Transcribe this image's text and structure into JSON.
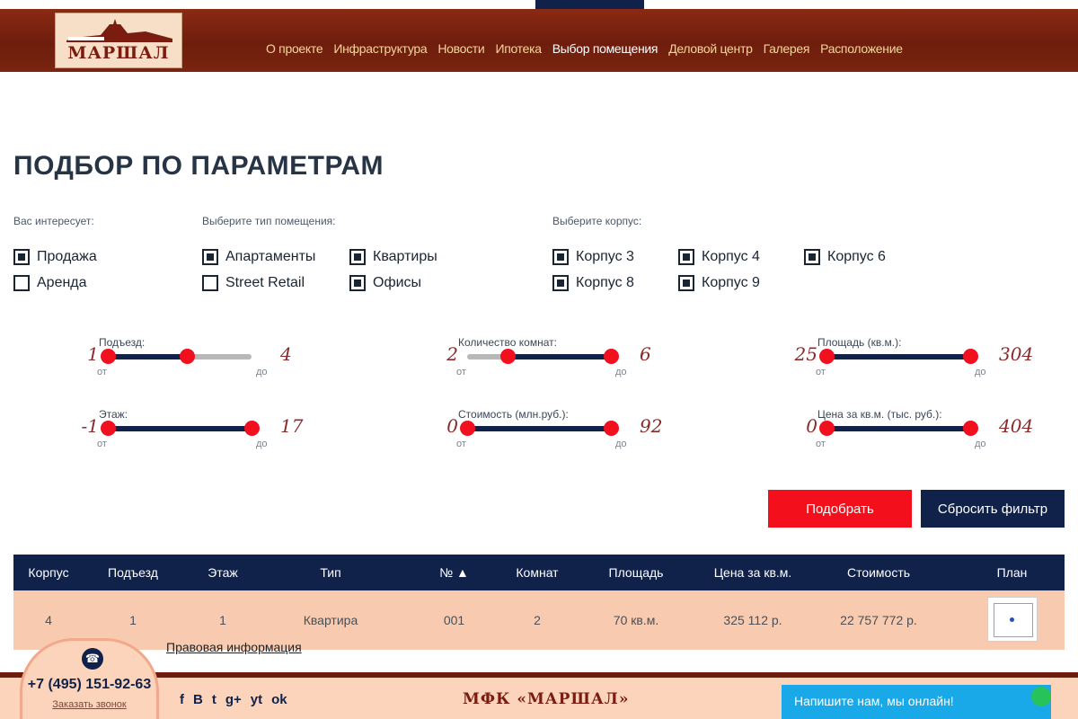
{
  "brand": {
    "logo_text": "МАРШАЛ",
    "footer_brand": "МФК «МАРШАЛ»"
  },
  "nav": [
    {
      "label": "О проекте",
      "active": false
    },
    {
      "label": "Инфраструктура",
      "active": false
    },
    {
      "label": "Новости",
      "active": false
    },
    {
      "label": "Ипотека",
      "active": false
    },
    {
      "label": "Выбор помещения",
      "active": true
    },
    {
      "label": "Деловой центр",
      "active": false
    },
    {
      "label": "Галерея",
      "active": false
    },
    {
      "label": "Расположение",
      "active": false
    }
  ],
  "page": {
    "title": "ПОДБОР ПО ПАРАМЕТРАМ"
  },
  "filters": {
    "interest": {
      "label": "Вас интересует:",
      "options": [
        {
          "label": "Продажа",
          "checked": true
        },
        {
          "label": "Аренда",
          "checked": false
        }
      ]
    },
    "type": {
      "label": "Выберите тип помещения:",
      "options": [
        {
          "label": "Апартаменты",
          "checked": true
        },
        {
          "label": "Street Retail",
          "checked": false
        },
        {
          "label": "Квартиры",
          "checked": true
        },
        {
          "label": "Офисы",
          "checked": true
        }
      ]
    },
    "building": {
      "label": "Выберите корпус:",
      "options": [
        {
          "label": "Корпус 3",
          "checked": true
        },
        {
          "label": "Корпус 8",
          "checked": true
        },
        {
          "label": "Корпус 4",
          "checked": true
        },
        {
          "label": "Корпус 9",
          "checked": true
        },
        {
          "label": "Корпус 6",
          "checked": true
        }
      ]
    }
  },
  "ranges": {
    "from_label": "от",
    "to_label": "до",
    "entrance": {
      "label": "Подъезд:",
      "min": "1",
      "max": "4",
      "lo": 0,
      "hi": 0.55
    },
    "floor": {
      "label": "Этаж:",
      "min": "-1",
      "max": "17",
      "lo": 0,
      "hi": 1
    },
    "rooms": {
      "label": "Количество комнат:",
      "min": "2",
      "max": "6",
      "lo": 0.28,
      "hi": 1
    },
    "cost": {
      "label": "Стоимость (млн.руб.):",
      "min": "0",
      "max": "92",
      "lo": 0,
      "hi": 1
    },
    "area": {
      "label": "Площадь (кв.м.):",
      "min": "25",
      "max": "304",
      "lo": 0,
      "hi": 1
    },
    "price_sqm": {
      "label": "Цена за кв.м. (тыс. руб.):",
      "min": "0",
      "max": "404",
      "lo": 0,
      "hi": 1
    }
  },
  "buttons": {
    "apply": "Подобрать",
    "reset": "Сбросить фильтр"
  },
  "table": {
    "headers": [
      "Корпус",
      "Подъезд",
      "Этаж",
      "Тип",
      "№ ▲",
      "Комнат",
      "Площадь",
      "Цена за кв.м.",
      "Стоимость",
      "План"
    ],
    "rows": [
      {
        "building": "4",
        "entrance": "1",
        "floor": "1",
        "type": "Квартира",
        "number": "001",
        "rooms": "2",
        "area": "70 кв.м.",
        "price_sqm": "325 112 р.",
        "cost": "22 757 772 р."
      }
    ]
  },
  "footer": {
    "legal": "Правовая информация",
    "phone": "+7 (495) 151-92-63",
    "callback": "Заказать звонок",
    "socials": [
      "f",
      "B",
      "t",
      "g+",
      "yt",
      "ok"
    ],
    "chat": "Напишите нам, мы онлайн!"
  },
  "colors": {
    "header": "#7a2411",
    "navy": "#10214a",
    "red": "#f3101c",
    "row": "#f8cbb0"
  }
}
